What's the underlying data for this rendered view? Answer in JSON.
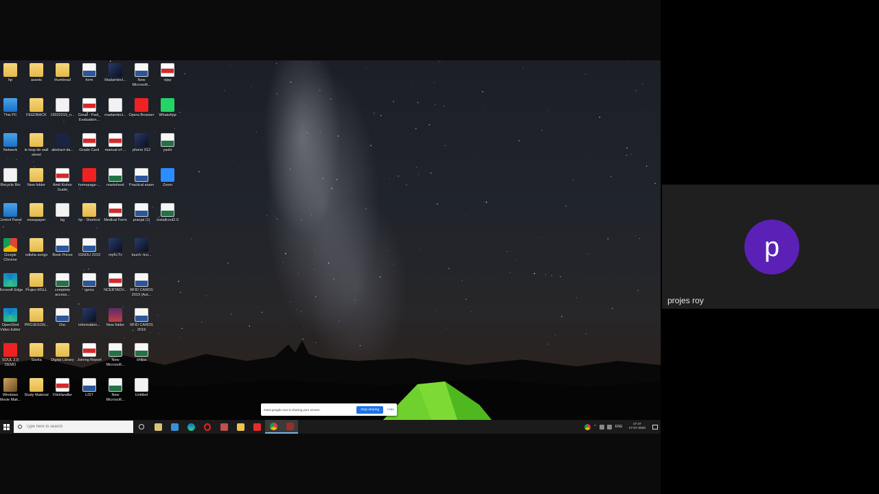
{
  "desktop": {
    "icons": [
      {
        "label": "hp",
        "kind": "folder"
      },
      {
        "label": "assets",
        "kind": "folder"
      },
      {
        "label": "thumbnail",
        "kind": "folder"
      },
      {
        "label": "form",
        "kind": "word"
      },
      {
        "label": "Madamlect...",
        "kind": "img"
      },
      {
        "label": "New Microsoft...",
        "kind": "word"
      },
      {
        "label": "vijay",
        "kind": "pdf"
      },
      {
        "label": "This PC",
        "kind": "blue"
      },
      {
        "label": "FEEDBACK",
        "kind": "folder"
      },
      {
        "label": "15022019_n...",
        "kind": "file"
      },
      {
        "label": "Gmail - Fwd_ Evaluation...",
        "kind": "pdf"
      },
      {
        "label": "madamlect...",
        "kind": "file"
      },
      {
        "label": "Opera Browser",
        "kind": "round-red"
      },
      {
        "label": "WhatsApp",
        "kind": "round-green"
      },
      {
        "label": "Network",
        "kind": "blue"
      },
      {
        "label": "le loup de wall street",
        "kind": "folder"
      },
      {
        "label": "abstract-da...",
        "kind": "dark"
      },
      {
        "label": "Grade Card",
        "kind": "pdf"
      },
      {
        "label": "manual-of-...",
        "kind": "pdf"
      },
      {
        "label": "phone 012",
        "kind": "img"
      },
      {
        "label": "yashi",
        "kind": "excel"
      },
      {
        "label": "Recycle Bin",
        "kind": "file"
      },
      {
        "label": "New folder",
        "kind": "folder"
      },
      {
        "label": "Amit Kishor Guide",
        "kind": "pdf"
      },
      {
        "label": "homepage-...",
        "kind": "round-red"
      },
      {
        "label": "marksheet",
        "kind": "excel"
      },
      {
        "label": "Practical exam",
        "kind": "word"
      },
      {
        "label": "Zoom",
        "kind": "round-blue"
      },
      {
        "label": "Control Panel",
        "kind": "blue"
      },
      {
        "label": "newspaper",
        "kind": "folder"
      },
      {
        "label": "bg",
        "kind": "file"
      },
      {
        "label": "hp - Shortcut",
        "kind": "folder"
      },
      {
        "label": "Medical Form",
        "kind": "pdf"
      },
      {
        "label": "pranjal (1)",
        "kind": "word"
      },
      {
        "label": "installcoul2.0",
        "kind": "excel"
      },
      {
        "label": "Google Chrome",
        "kind": "chrome"
      },
      {
        "label": "odisha songs",
        "kind": "folder"
      },
      {
        "label": "Book Prices",
        "kind": "word"
      },
      {
        "label": "IGNOU 2019",
        "kind": "word"
      },
      {
        "label": "myKcTv",
        "kind": "img"
      },
      {
        "label": "touch--tco...",
        "kind": "img"
      },
      {
        "label": "",
        "kind": "none"
      },
      {
        "label": "Microsoft Edge",
        "kind": "edge"
      },
      {
        "label": "Projes MSLL",
        "kind": "folder"
      },
      {
        "label": "complete access...",
        "kind": "excel"
      },
      {
        "label": "ignou",
        "kind": "word"
      },
      {
        "label": "NCERTADV...",
        "kind": "pdf"
      },
      {
        "label": "RFID CARDS 2019 (Aut...",
        "kind": "word"
      },
      {
        "label": "",
        "kind": "none"
      },
      {
        "label": "OpenShot Video Editor",
        "kind": "edge"
      },
      {
        "label": "PROJESGN...",
        "kind": "folder"
      },
      {
        "label": "Doc",
        "kind": "word"
      },
      {
        "label": "information...",
        "kind": "img"
      },
      {
        "label": "New folder",
        "kind": "video"
      },
      {
        "label": "RFID CARDS 2019",
        "kind": "word"
      },
      {
        "label": "",
        "kind": "none"
      },
      {
        "label": "SOUL 2.0 DEMO",
        "kind": "round-red"
      },
      {
        "label": "Savita",
        "kind": "folder"
      },
      {
        "label": "Digital Library",
        "kind": "folder"
      },
      {
        "label": "Joining Report",
        "kind": "pdf"
      },
      {
        "label": "New Microsoft...",
        "kind": "excel"
      },
      {
        "label": "shilpa",
        "kind": "excel"
      },
      {
        "label": "",
        "kind": "none"
      },
      {
        "label": "Windows Movie Mak...",
        "kind": "photo"
      },
      {
        "label": "Study Material",
        "kind": "folder"
      },
      {
        "label": "FileHandler",
        "kind": "pdf"
      },
      {
        "label": "LIST",
        "kind": "word"
      },
      {
        "label": "New Microsoft...",
        "kind": "excel"
      },
      {
        "label": "Untitled",
        "kind": "file"
      },
      {
        "label": "",
        "kind": "none"
      }
    ]
  },
  "share_banner": {
    "text": "meet.google.com is sharing your screen.",
    "stop_label": "Stop sharing",
    "hide_label": "Hide"
  },
  "taskbar": {
    "search_placeholder": "Type here to search",
    "apps": [
      "task-view",
      "store",
      "mail",
      "edge",
      "opera",
      "media",
      "file-explorer",
      "youtube",
      "chrome",
      "app"
    ],
    "tray_lang": "ENG",
    "time": "17:47",
    "date": "17-07-2020"
  },
  "meet": {
    "participant_initial": "p",
    "participant_name": "projes roy",
    "avatar_color": "#5b21b6"
  }
}
